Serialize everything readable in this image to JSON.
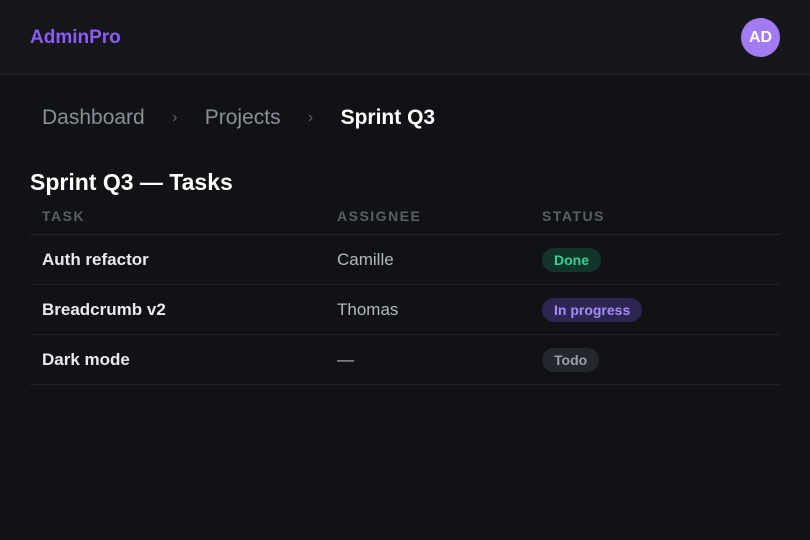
{
  "app": {
    "brand": "AdminPro",
    "avatar_initials": "AD"
  },
  "breadcrumb": {
    "items": [
      "Dashboard",
      "Projects"
    ],
    "current": "Sprint Q3",
    "separator": "›"
  },
  "page": {
    "title": "Sprint Q3 — Tasks"
  },
  "table": {
    "columns": [
      "TASK",
      "ASSIGNEE",
      "STATUS"
    ],
    "rows": [
      {
        "task": "Auth refactor",
        "assignee": "Camille",
        "status": "Done"
      },
      {
        "task": "Breadcrumb v2",
        "assignee": "Thomas",
        "status": "In progress"
      },
      {
        "task": "Dark mode",
        "assignee": "—",
        "status": "Todo"
      }
    ]
  },
  "colors": {
    "accent": "#8b5cf6",
    "avatar_bg": "#a27bf2",
    "status_done": "#34d399",
    "status_in_progress": "#a78bfa",
    "status_todo": "#9aa0aa"
  }
}
